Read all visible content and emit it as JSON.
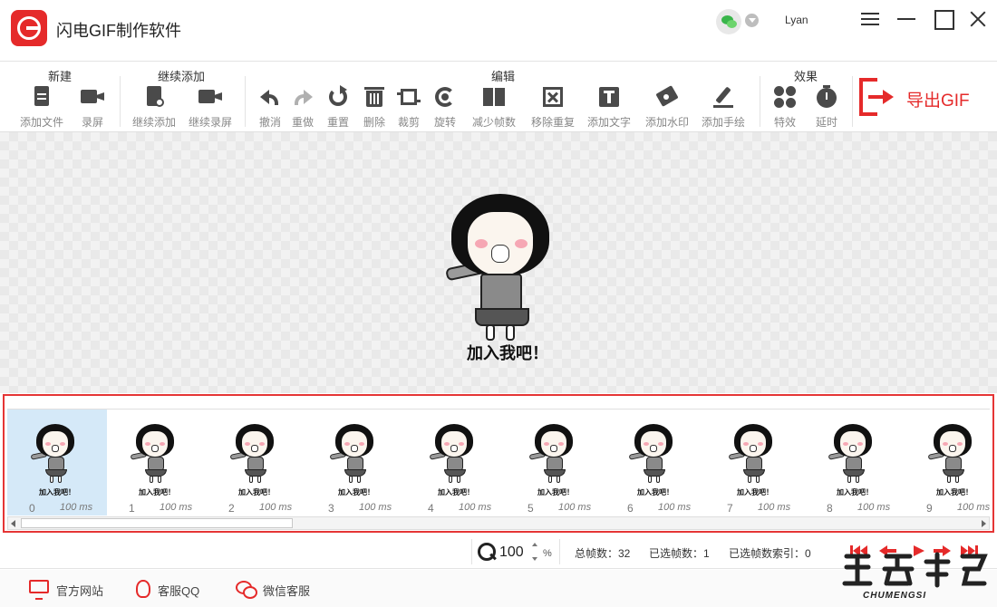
{
  "app": {
    "title": "闪电GIF制作软件",
    "user": "Lyan"
  },
  "toolbar": {
    "groups": [
      {
        "label": "新建"
      },
      {
        "label": "继续添加"
      },
      {
        "label": "编辑"
      },
      {
        "label": "效果"
      }
    ],
    "tools": [
      {
        "label": "添加文件",
        "icon": "add-file-icon"
      },
      {
        "label": "录屏",
        "icon": "record-screen-icon"
      },
      {
        "label": "继续添加",
        "icon": "continue-add-icon"
      },
      {
        "label": "继续录屏",
        "icon": "continue-record-icon"
      },
      {
        "label": "撤消",
        "icon": "undo-icon"
      },
      {
        "label": "重做",
        "icon": "redo-icon"
      },
      {
        "label": "重置",
        "icon": "reset-icon"
      },
      {
        "label": "删除",
        "icon": "trash-icon"
      },
      {
        "label": "裁剪",
        "icon": "crop-icon"
      },
      {
        "label": "旋转",
        "icon": "rotate-icon"
      },
      {
        "label": "减少帧数",
        "icon": "reduce-frames-icon"
      },
      {
        "label": "移除重复",
        "icon": "remove-duplicates-icon"
      },
      {
        "label": "添加文字",
        "icon": "add-text-icon"
      },
      {
        "label": "添加水印",
        "icon": "add-watermark-icon"
      },
      {
        "label": "添加手绘",
        "icon": "add-drawing-icon"
      },
      {
        "label": "特效",
        "icon": "effects-icon"
      },
      {
        "label": "延时",
        "icon": "delay-timer-icon"
      }
    ],
    "export_label": "导出GIF"
  },
  "preview": {
    "caption": "加入我吧！"
  },
  "frames": {
    "caption": "加入我吧！",
    "selected_index": 0,
    "items": [
      {
        "index": "0",
        "duration": "100 ms"
      },
      {
        "index": "1",
        "duration": "100 ms"
      },
      {
        "index": "2",
        "duration": "100 ms"
      },
      {
        "index": "3",
        "duration": "100 ms"
      },
      {
        "index": "4",
        "duration": "100 ms"
      },
      {
        "index": "5",
        "duration": "100 ms"
      },
      {
        "index": "6",
        "duration": "100 ms"
      },
      {
        "index": "7",
        "duration": "100 ms"
      },
      {
        "index": "8",
        "duration": "100 ms"
      },
      {
        "index": "9",
        "duration": "100 ms"
      }
    ]
  },
  "status": {
    "zoom": "100",
    "zoom_unit": "%",
    "total_frames": "总帧数：32",
    "selected_frames": "已选帧数：1",
    "selected_index": "已选帧数索引：0"
  },
  "footer": {
    "website": "官方网站",
    "qq": "客服QQ",
    "wechat": "微信客服"
  },
  "watermark": {
    "sub": "CHUMENGSI"
  },
  "colors": {
    "accent": "#e52a2a",
    "selected_frame": "#d5e9f8"
  }
}
